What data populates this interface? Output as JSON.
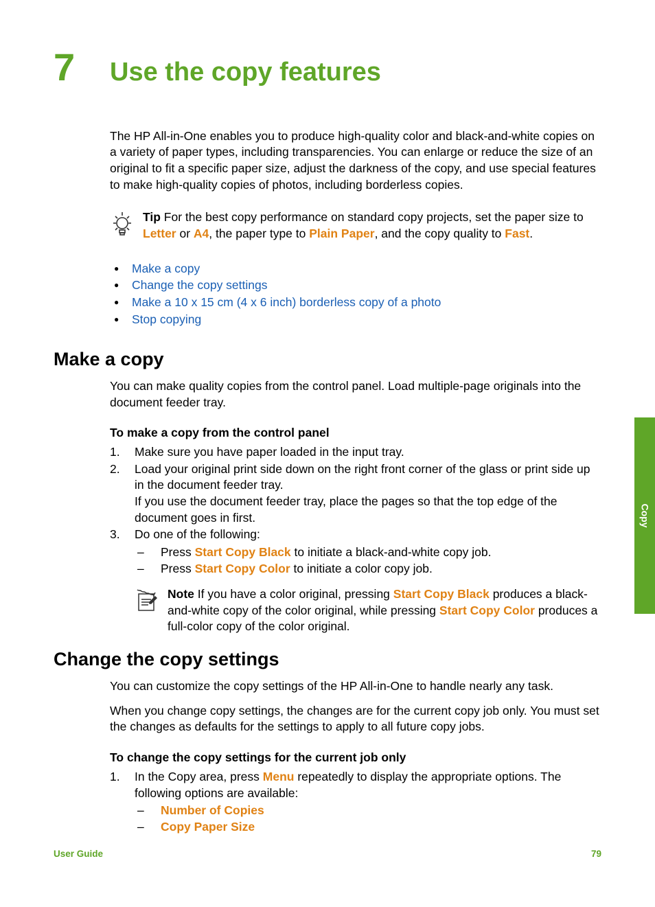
{
  "chapter": {
    "number": "7",
    "title": "Use the copy features"
  },
  "intro": "The HP All-in-One enables you to produce high-quality color and black-and-white copies on a variety of paper types, including transparencies. You can enlarge or reduce the size of an original to fit a specific paper size, adjust the darkness of the copy, and use special features to make high-quality copies of photos, including borderless copies.",
  "tip": {
    "label": "Tip",
    "pre": "  For the best copy performance on standard copy projects, set the paper size to ",
    "letter": "Letter",
    "or": " or ",
    "a4": "A4",
    "mid": ", the paper type to ",
    "plain": "Plain Paper",
    "mid2": ", and the copy quality to ",
    "fast": "Fast",
    "end": "."
  },
  "toc": {
    "link1": "Make a copy",
    "link2": "Change the copy settings",
    "link3": "Make a 10 x 15 cm (4 x 6 inch) borderless copy of a photo",
    "link4": "Stop copying"
  },
  "section1": {
    "heading": "Make a copy",
    "para": "You can make quality copies from the control panel. Load multiple-page originals into the document feeder tray.",
    "sub_heading": "To make a copy from the control panel",
    "step1": "Make sure you have paper loaded in the input tray.",
    "step2a": "Load your original print side down on the right front corner of the glass or print side up in the document feeder tray.",
    "step2b": "If you use the document feeder tray, place the pages so that the top edge of the document goes in first.",
    "step3": "Do one of the following:",
    "sub1_pre": "Press ",
    "sub1_b": "Start Copy Black",
    "sub1_post": " to initiate a black-and-white copy job.",
    "sub2_pre": "Press ",
    "sub2_b": "Start Copy Color",
    "sub2_post": " to initiate a color copy job.",
    "note_label": "Note",
    "note_pre": "  If you have a color original, pressing ",
    "note_b1": "Start Copy Black",
    "note_mid": " produces a black-and-white copy of the color original, while pressing ",
    "note_b2": "Start Copy Color",
    "note_post": " produces a full-color copy of the color original."
  },
  "section2": {
    "heading": "Change the copy settings",
    "para1": "You can customize the copy settings of the HP All-in-One to handle nearly any task.",
    "para2": "When you change copy settings, the changes are for the current copy job only. You must set the changes as defaults for the settings to apply to all future copy jobs.",
    "sub_heading": "To change the copy settings for the current job only",
    "step1_pre": "In the Copy area, press ",
    "step1_b": "Menu",
    "step1_post": " repeatedly to display the appropriate options. The following options are available:",
    "opt1": "Number of Copies",
    "opt2": "Copy Paper Size"
  },
  "side_tab": "Copy",
  "footer": {
    "left": "User Guide",
    "right": "79"
  }
}
